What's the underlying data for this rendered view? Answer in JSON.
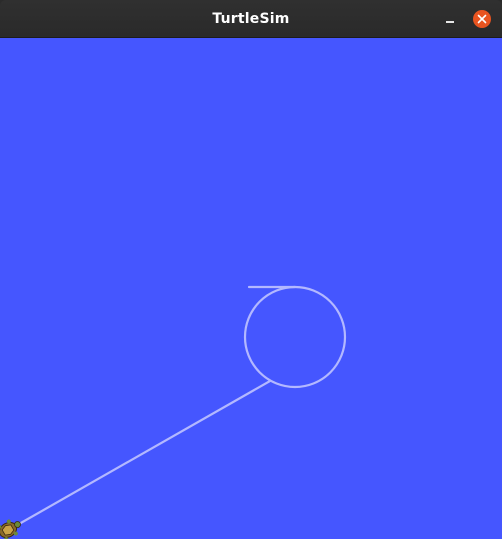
{
  "window": {
    "title": "TurtleSim"
  },
  "titlebar": {
    "minimize_icon": "minimize-icon",
    "close_icon": "close-icon",
    "close_color": "#e95420"
  },
  "canvas": {
    "background_color": "#4556ff",
    "pen_color": "#b3b8ff",
    "turtle_icon": "turtle-icon"
  }
}
